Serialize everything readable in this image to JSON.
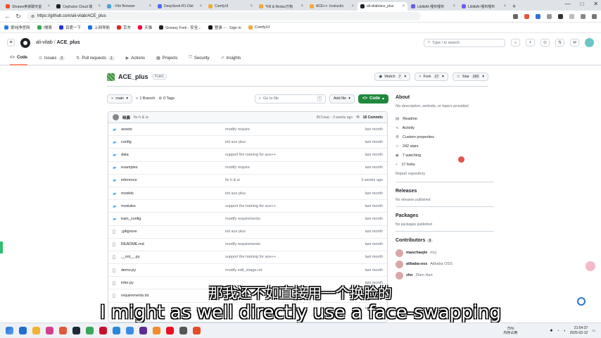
{
  "browser": {
    "tabs": [
      {
        "title": "Shopee卖家聊天室",
        "color": "#ee4d2d",
        "active": false
      },
      {
        "title": "Cephalon Cloud 端",
        "color": "#222222",
        "active": false
      },
      {
        "title": "- File Browser",
        "color": "#4aa3df",
        "active": false
      },
      {
        "title": "DeepSeek-R1-Dist",
        "color": "#4a6cf7",
        "active": false
      },
      {
        "title": "ComfyUI",
        "color": "#f2a93b",
        "active": false
      },
      {
        "title": "*Fill & Redux万物",
        "color": "#f2a93b",
        "active": false
      },
      {
        "title": "ACE++: Instructio",
        "color": "#f2a93b",
        "active": false
      },
      {
        "title": "ali-vilab/ace_plus",
        "color": "#1f2328",
        "active": true
      },
      {
        "title": "LiblibAI-哩布哩布",
        "color": "#6b5cf6",
        "active": false
      },
      {
        "title": "LiblibAI-哩布哩布",
        "color": "#6b5cf6",
        "active": false
      }
    ],
    "new_tab": "+",
    "window_controls": [
      "—",
      "□",
      "✕"
    ],
    "url": "https://github.com/ali-vilab/ACE_plus",
    "bookmarks": [
      {
        "label": "爱纯净官网",
        "color": "#2d7be5"
      },
      {
        "label": "/搜索",
        "color": "#3aa657"
      },
      {
        "label": "百度一下",
        "color": "#2932e1"
      },
      {
        "label": "上网导航",
        "color": "#1a73e8"
      },
      {
        "label": "京东",
        "color": "#e1251b"
      },
      {
        "label": "天猫",
        "color": "#ff0036"
      },
      {
        "label": "Greasy Fork - 安全...",
        "color": "#222222"
      },
      {
        "label": "登录 -- · Sign in",
        "color": "#111111"
      },
      {
        "label": "ComfyUI",
        "color": "#f2a93b"
      }
    ]
  },
  "github": {
    "owner": "ali-vilab",
    "repo": "ACE_plus",
    "search_placeholder": "Type / to search",
    "search_key": "/",
    "tabs": [
      {
        "icon": "<>",
        "label": "Code",
        "count": "",
        "active": true
      },
      {
        "icon": "⊙",
        "label": "Issues",
        "count": "2",
        "active": false
      },
      {
        "icon": "⇅",
        "label": "Pull requests",
        "count": "1",
        "active": false
      },
      {
        "icon": "▶",
        "label": "Actions",
        "count": "",
        "active": false
      },
      {
        "icon": "▦",
        "label": "Projects",
        "count": "",
        "active": false
      },
      {
        "icon": "⛉",
        "label": "Security",
        "count": "",
        "active": false
      },
      {
        "icon": "↗",
        "label": "Insights",
        "count": "",
        "active": false
      }
    ],
    "repo_name": "ACE_plus",
    "visibility": "Public",
    "watch": {
      "label": "Watch",
      "count": "7"
    },
    "fork": {
      "label": "Fork",
      "count": "17"
    },
    "star": {
      "label": "Star",
      "count": "242"
    },
    "branch": "main",
    "branches": "1 Branch",
    "tags": "0 Tags",
    "go_to_file": "Go to file",
    "go_to_file_key": "t",
    "add_file": "Add file",
    "code_button": "Code",
    "commit": {
      "author": "晓晨",
      "message": "fix h & w",
      "meta": "957ceac · 3 weeks ago",
      "count": "18 Commits"
    },
    "files": [
      {
        "type": "dir",
        "name": "assets",
        "message": "modify require",
        "date": "last month"
      },
      {
        "type": "dir",
        "name": "config",
        "message": "init ace plus",
        "date": "last month"
      },
      {
        "type": "dir",
        "name": "data",
        "message": "support the training for ace++.",
        "date": "last month"
      },
      {
        "type": "dir",
        "name": "examples",
        "message": "modify require",
        "date": "last month"
      },
      {
        "type": "dir",
        "name": "inference",
        "message": "fix h & w",
        "date": "3 weeks ago"
      },
      {
        "type": "dir",
        "name": "models",
        "message": "init ace plus",
        "date": "last month"
      },
      {
        "type": "dir",
        "name": "modules",
        "message": "support the training for ace++.",
        "date": "last month"
      },
      {
        "type": "dir",
        "name": "train_config",
        "message": "modify requirements",
        "date": "last month"
      },
      {
        "type": "file",
        "name": ".gitignore",
        "message": "init ace plus",
        "date": "last month"
      },
      {
        "type": "file",
        "name": "README.md",
        "message": "modify requirements",
        "date": "last month"
      },
      {
        "type": "file",
        "name": "__init__.py",
        "message": "support the training for ace++.",
        "date": "last month"
      },
      {
        "type": "file",
        "name": "demo.py",
        "message": "modify edit_image.ret",
        "date": "last month"
      },
      {
        "type": "file",
        "name": "infer.py",
        "message": "",
        "date": "last month"
      },
      {
        "type": "file",
        "name": "requirements.txt",
        "message": "",
        "date": "last month"
      },
      {
        "type": "file",
        "name": "",
        "message": "",
        "date": "last month"
      }
    ],
    "about": {
      "title": "About",
      "description": "No description, website, or topics provided.",
      "items": [
        {
          "icon": "▤",
          "label": "Readme"
        },
        {
          "icon": "∿",
          "label": "Activity"
        },
        {
          "icon": "⚙",
          "label": "Custom properties"
        },
        {
          "icon": "☆",
          "label": "242 stars"
        },
        {
          "icon": "◉",
          "label": "7 watching"
        },
        {
          "icon": "⑂",
          "label": "17 forks"
        }
      ],
      "report": "Report repository"
    },
    "releases": {
      "title": "Releases",
      "note": "No releases published"
    },
    "packages": {
      "title": "Packages",
      "note": "No packages published"
    },
    "contributors": {
      "title": "Contributors",
      "count": "3",
      "list": [
        {
          "handle": "maochaojie",
          "name": "mcj"
        },
        {
          "handle": "alibaba-oss",
          "name": "Alibaba OSS"
        },
        {
          "handle": "zhn",
          "name": "Zhen Han"
        }
      ]
    }
  },
  "subtitles": {
    "zh": "那我还不如直接用一个换脸的",
    "en": "I might as well directly use a face-swapping"
  },
  "taskbar": {
    "apps": [
      "#1f6fd1",
      "#f2b233",
      "#d43f8d",
      "#e05a3a",
      "#1b2838",
      "#3aa657",
      "#c8102e",
      "#2b88d8",
      "#3c8ce7",
      "#5c2d91",
      "#f28c28",
      "#e81123",
      "#555555",
      "#e34c26"
    ],
    "mem_percent": "75%",
    "mem_label": "内存占用",
    "time": "21:54:37",
    "date": "2025-02-12"
  }
}
